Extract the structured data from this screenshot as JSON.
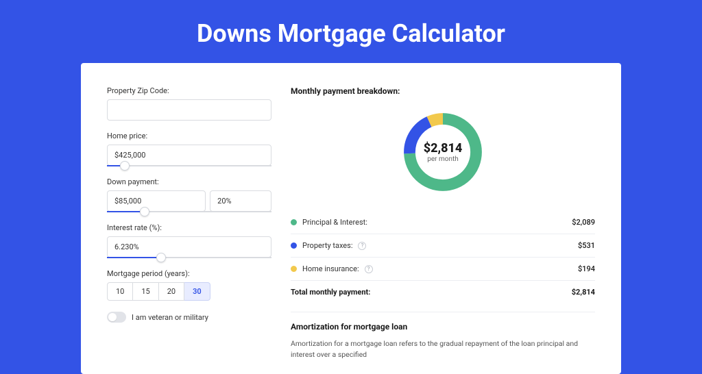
{
  "page_title": "Downs Mortgage Calculator",
  "form": {
    "zip_label": "Property Zip Code:",
    "zip_value": "",
    "home_price_label": "Home price:",
    "home_price_value": "$425,000",
    "home_price_slider_pct": 8,
    "down_payment_label": "Down payment:",
    "down_payment_value": "$85,000",
    "down_payment_pct_value": "20%",
    "down_payment_slider_pct": 20,
    "interest_label": "Interest rate (%):",
    "interest_value": "6.230%",
    "interest_slider_pct": 30,
    "period_label": "Mortgage period (years):",
    "periods": [
      "10",
      "15",
      "20",
      "30"
    ],
    "period_active_index": 3,
    "veteran_label": "I am veteran or military",
    "veteran_on": false
  },
  "breakdown": {
    "title": "Monthly payment breakdown:",
    "total_amount": "$2,814",
    "per_month": "per month",
    "items": [
      {
        "label": "Principal & Interest:",
        "value": "$2,089",
        "color": "green",
        "info": false
      },
      {
        "label": "Property taxes:",
        "value": "$531",
        "color": "blue",
        "info": true
      },
      {
        "label": "Home insurance:",
        "value": "$194",
        "color": "yellow",
        "info": true
      }
    ],
    "total_label": "Total monthly payment:",
    "total_value": "$2,814"
  },
  "amortization": {
    "title": "Amortization for mortgage loan",
    "text": "Amortization for a mortgage loan refers to the gradual repayment of the loan principal and interest over a specified"
  },
  "chart_data": {
    "type": "pie",
    "title": "Monthly payment breakdown",
    "series": [
      {
        "name": "Principal & Interest",
        "value": 2089,
        "color": "#4eb889"
      },
      {
        "name": "Property taxes",
        "value": 531,
        "color": "#3353e6"
      },
      {
        "name": "Home insurance",
        "value": 194,
        "color": "#f2c94c"
      }
    ],
    "total": 2814,
    "unit": "USD per month"
  }
}
